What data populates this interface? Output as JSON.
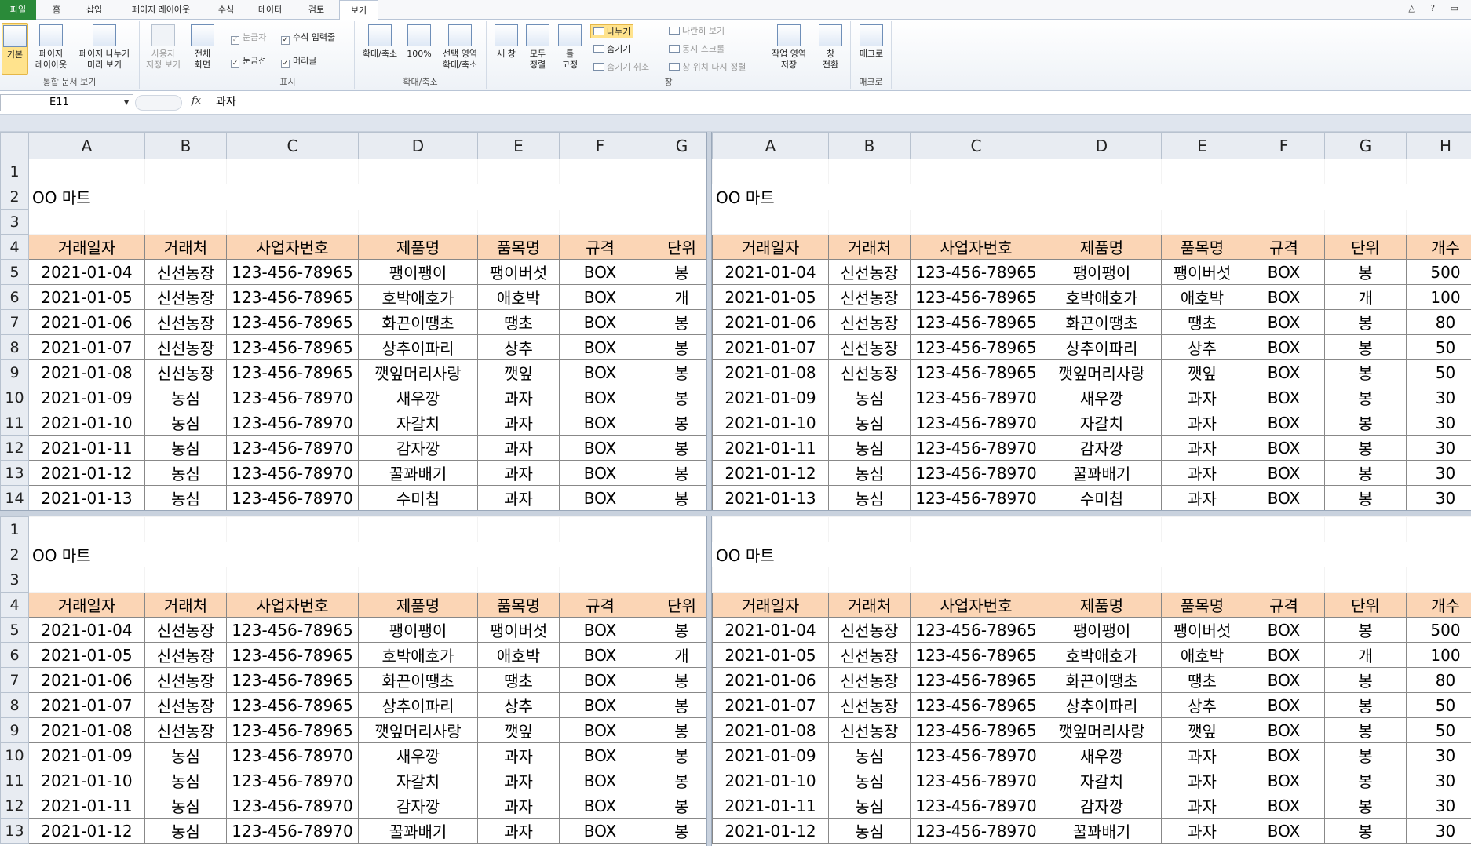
{
  "window": {
    "controls": "△ ? ▭"
  },
  "tabs": [
    {
      "label": "파일"
    },
    {
      "label": "홈"
    },
    {
      "label": "삽입"
    },
    {
      "label": "페이지 레이아웃"
    },
    {
      "label": "수식"
    },
    {
      "label": "데이터"
    },
    {
      "label": "검토"
    },
    {
      "label": "보기"
    }
  ],
  "ribbon": {
    "views": {
      "group": "통합 문서 보기",
      "normal": "기본",
      "page_layout_1": "페이지",
      "page_layout_2": "레이아웃",
      "page_break_1": "페이지 나누기",
      "page_break_2": "미리 보기",
      "custom_1": "사용자",
      "custom_2": "지정 보기",
      "full_1": "전체",
      "full_2": "화면"
    },
    "show": {
      "group": "표시",
      "ruler": "눈금자",
      "formula_bar": "수식 입력줄",
      "gridlines": "눈금선",
      "headings": "머리글"
    },
    "zoom": {
      "group": "확대/축소",
      "zoom": "확대/축소",
      "hundred": "100%",
      "selection_1": "선택 영역",
      "selection_2": "확대/축소"
    },
    "window": {
      "group": "창",
      "new_1": "새 창",
      "arrange_1": "모두",
      "arrange_2": "정렬",
      "freeze_1": "틀",
      "freeze_2": "고정",
      "split": "나누기",
      "hide": "숨기기",
      "unhide": "숨기기 취소",
      "side_by_side": "나란히 보기",
      "sync_scroll": "동시 스크롤",
      "reset_position": "창 위치 다시 정렬",
      "save_ws_1": "작업 영역",
      "save_ws_2": "저장",
      "switch_1": "창",
      "switch_2": "전환"
    },
    "macros": {
      "group": "매크로",
      "macro": "매크로"
    }
  },
  "formula_bar": {
    "cell_ref": "E11",
    "fx": "fx",
    "content": "과자"
  },
  "sheet": {
    "columns": [
      "A",
      "B",
      "C",
      "D",
      "E",
      "F",
      "G",
      "H"
    ],
    "title": "OO 마트",
    "headers": [
      "거래일자",
      "거래처",
      "사업자번호",
      "제품명",
      "품목명",
      "규격",
      "단위",
      "개수"
    ],
    "rows": [
      [
        "2021-01-04",
        "신선농장",
        "123-456-78965",
        "팽이팽이",
        "팽이버섯",
        "BOX",
        "봉",
        "500"
      ],
      [
        "2021-01-05",
        "신선농장",
        "123-456-78965",
        "호박애호가",
        "애호박",
        "BOX",
        "개",
        "100"
      ],
      [
        "2021-01-06",
        "신선농장",
        "123-456-78965",
        "화끈이땡초",
        "땡초",
        "BOX",
        "봉",
        "80"
      ],
      [
        "2021-01-07",
        "신선농장",
        "123-456-78965",
        "상추이파리",
        "상추",
        "BOX",
        "봉",
        "50"
      ],
      [
        "2021-01-08",
        "신선농장",
        "123-456-78965",
        "깻잎머리사랑",
        "깻잎",
        "BOX",
        "봉",
        "50"
      ],
      [
        "2021-01-09",
        "농심",
        "123-456-78970",
        "새우깡",
        "과자",
        "BOX",
        "봉",
        "30"
      ],
      [
        "2021-01-10",
        "농심",
        "123-456-78970",
        "자갈치",
        "과자",
        "BOX",
        "봉",
        "30"
      ],
      [
        "2021-01-11",
        "농심",
        "123-456-78970",
        "감자깡",
        "과자",
        "BOX",
        "봉",
        "30"
      ],
      [
        "2021-01-12",
        "농심",
        "123-456-78970",
        "꿀꽈배기",
        "과자",
        "BOX",
        "봉",
        "30"
      ],
      [
        "2021-01-13",
        "농심",
        "123-456-78970",
        "수미칩",
        "과자",
        "BOX",
        "봉",
        "30"
      ]
    ],
    "row_numbers": [
      "1",
      "2",
      "3",
      "4",
      "5",
      "6",
      "7",
      "8",
      "9",
      "10",
      "11",
      "12",
      "13",
      "14"
    ]
  }
}
